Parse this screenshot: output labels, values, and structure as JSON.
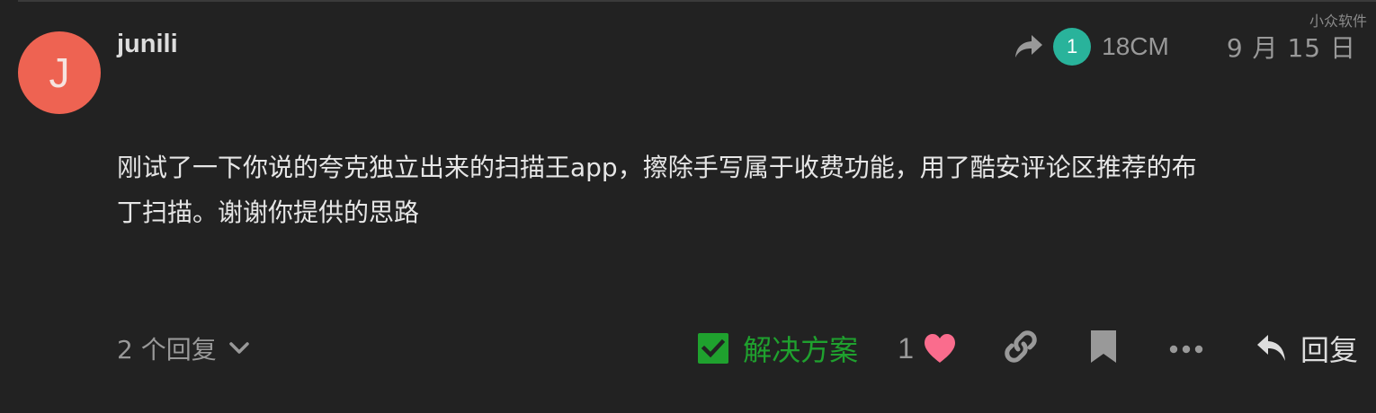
{
  "watermark": "小众软件",
  "post": {
    "avatar_letter": "J",
    "username": "junili",
    "reply_to": {
      "count": "1",
      "username": "18CM"
    },
    "date": "9 月 15 日",
    "body_line1": "刚试了一下你说的夸克独立出来的扫描王app，擦除手写属于收费功能，用了酷安评论区推荐的布",
    "body_line2": "丁扫描。谢谢你提供的思路"
  },
  "footer": {
    "replies_label": "2 个回复",
    "solution_label": "解决方案",
    "like_count": "1",
    "reply_label": "回复"
  },
  "colors": {
    "background": "#222222",
    "avatar": "#ee6352",
    "badge": "#29b39b",
    "solution": "#1fa12e",
    "heart": "#fa6c8d",
    "muted": "#999999"
  }
}
